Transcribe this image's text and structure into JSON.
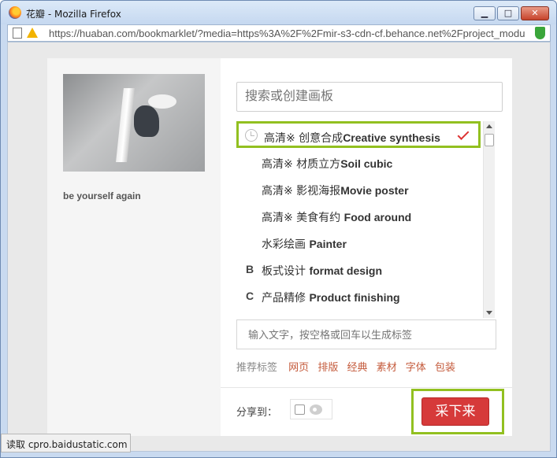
{
  "window": {
    "title": "花瓣 - Mozilla Firefox",
    "minimize_glyph": "▁",
    "maximize_glyph": "□",
    "close_glyph": "✕"
  },
  "urlbar": {
    "url": "https://huaban.com/bookmarklet/?media=https%3A%2F%2Fmir-s3-cdn-cf.behance.net%2Fproject_modu"
  },
  "preview": {
    "caption": "be yourself again"
  },
  "search": {
    "placeholder": "搜索或创建画板"
  },
  "boards": [
    {
      "prefix": "高清※ 创意合成",
      "name": "Creative synthesis",
      "letter": "",
      "selected": true
    },
    {
      "prefix": "高清※ 材质立方",
      "name": "Soil cubic",
      "letter": "",
      "selected": false
    },
    {
      "prefix": "高清※ 影视海报",
      "name": "Movie poster",
      "letter": "",
      "selected": false
    },
    {
      "prefix": "高清※ 美食有约 ",
      "name": "Food around",
      "letter": "",
      "selected": false
    },
    {
      "prefix": "水彩绘画 ",
      "name": "Painter",
      "letter": "",
      "selected": false
    },
    {
      "prefix": "板式设计 ",
      "name": "format design",
      "letter": "B",
      "selected": false
    },
    {
      "prefix": "产品精修 ",
      "name": "Product finishing",
      "letter": "C",
      "selected": false
    }
  ],
  "tag_input": {
    "placeholder": "输入文字，按空格或回车以生成标签"
  },
  "recommended": {
    "label": "推荐标签",
    "tags": [
      "网页",
      "排版",
      "经典",
      "素材",
      "字体",
      "包装"
    ]
  },
  "share": {
    "label": "分享到："
  },
  "submit": {
    "label": "采下来"
  },
  "status": {
    "text": "读取 cpro.baidustatic.com"
  },
  "colors": {
    "accent": "#d63a3a",
    "highlight": "#92c020",
    "tag": "#c45a3b"
  },
  "icons": {
    "browser": "firefox-icon",
    "recent": "clock-icon",
    "selected": "check-icon",
    "share": "weibo-icon"
  }
}
